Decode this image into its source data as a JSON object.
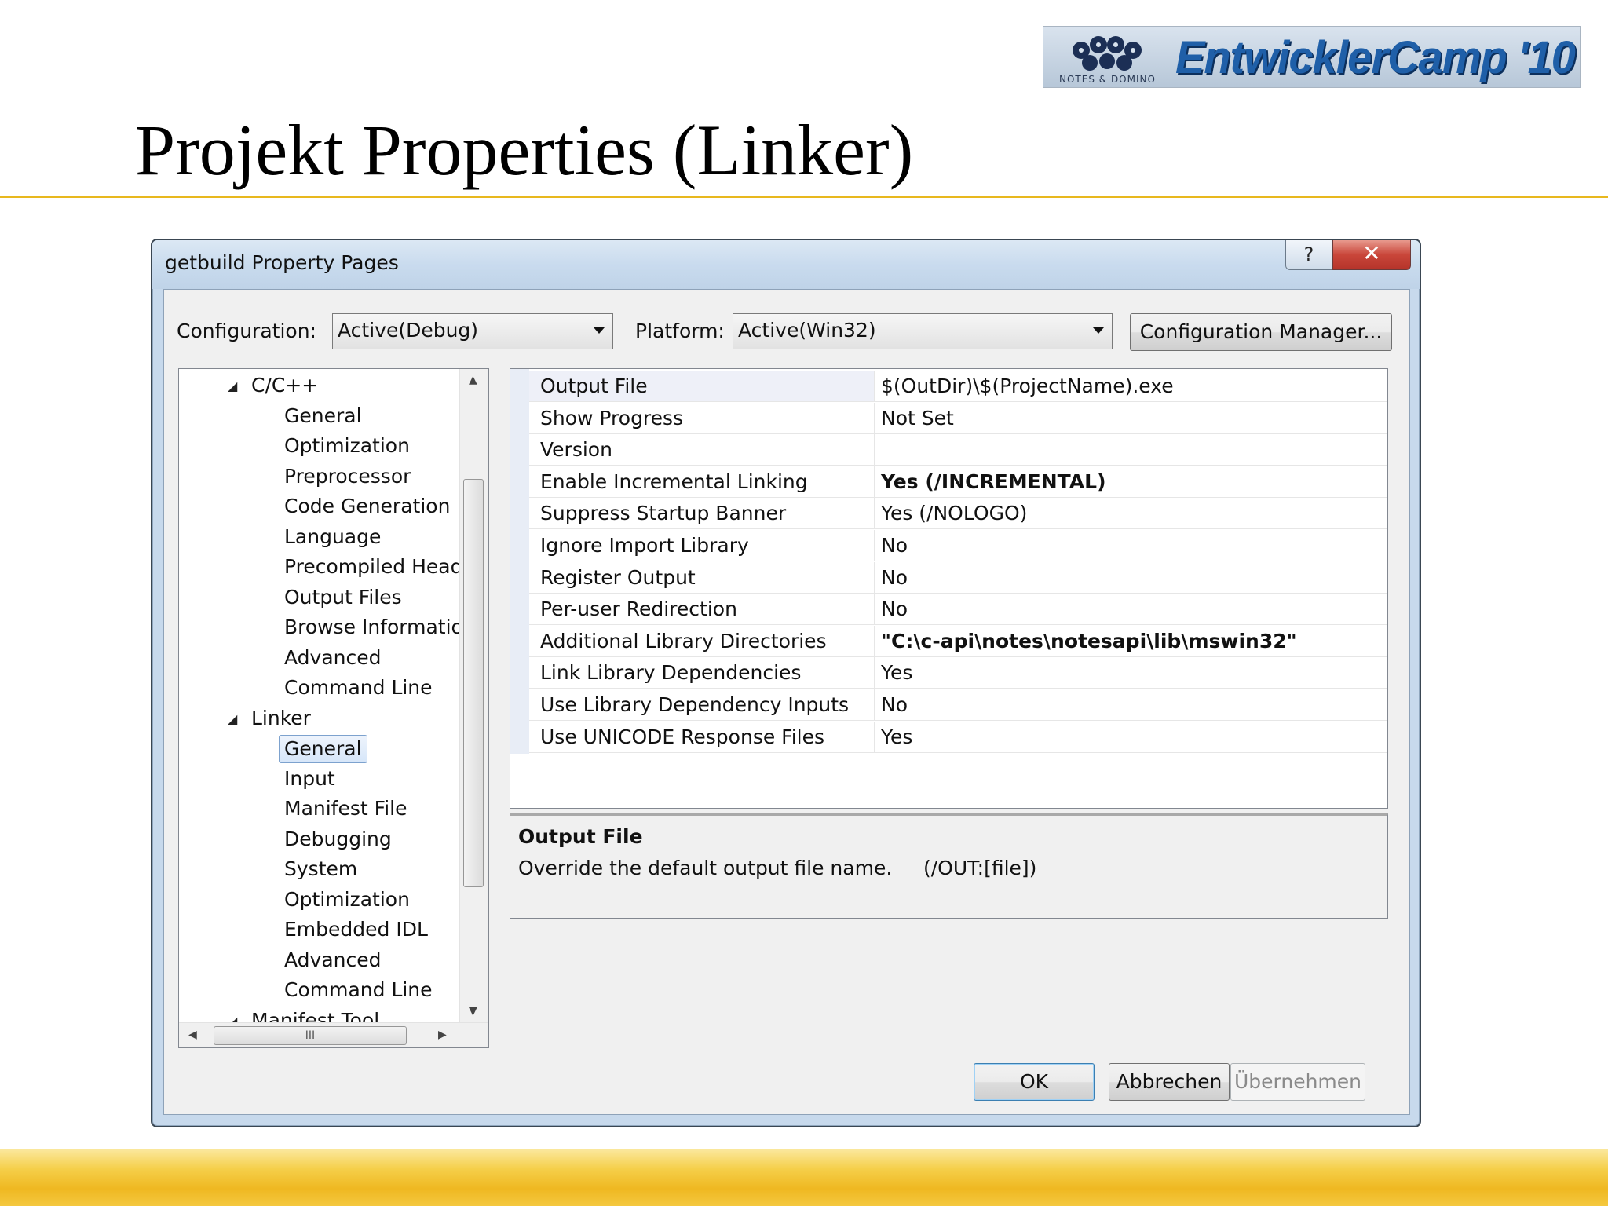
{
  "slide": {
    "title": "Projekt Properties (Linker)",
    "logo_text": "EntwicklerCamp",
    "logo_year": "'10",
    "logo_sub": "NOTES & DOMINO"
  },
  "window": {
    "title": "getbuild Property Pages",
    "help_label": "?",
    "close_label": "✕"
  },
  "toolbar": {
    "configuration_label": "Configuration:",
    "configuration_value": "Active(Debug)",
    "platform_label": "Platform:",
    "platform_value": "Active(Win32)",
    "config_manager_label": "Configuration Manager..."
  },
  "tree": {
    "items": [
      {
        "label": "C/C++",
        "level": 1,
        "expanded": true
      },
      {
        "label": "General",
        "level": 2
      },
      {
        "label": "Optimization",
        "level": 2
      },
      {
        "label": "Preprocessor",
        "level": 2
      },
      {
        "label": "Code Generation",
        "level": 2
      },
      {
        "label": "Language",
        "level": 2
      },
      {
        "label": "Precompiled Heade",
        "level": 2
      },
      {
        "label": "Output Files",
        "level": 2
      },
      {
        "label": "Browse Information",
        "level": 2
      },
      {
        "label": "Advanced",
        "level": 2
      },
      {
        "label": "Command Line",
        "level": 2
      },
      {
        "label": "Linker",
        "level": 1,
        "expanded": true
      },
      {
        "label": "General",
        "level": 2,
        "selected": true
      },
      {
        "label": "Input",
        "level": 2
      },
      {
        "label": "Manifest File",
        "level": 2
      },
      {
        "label": "Debugging",
        "level": 2
      },
      {
        "label": "System",
        "level": 2
      },
      {
        "label": "Optimization",
        "level": 2
      },
      {
        "label": "Embedded IDL",
        "level": 2
      },
      {
        "label": "Advanced",
        "level": 2
      },
      {
        "label": "Command Line",
        "level": 2
      },
      {
        "label": "Manifest Tool",
        "level": 1,
        "expanded": true
      }
    ],
    "hscroll_grip": "III"
  },
  "properties": [
    {
      "name": "Output File",
      "value": "$(OutDir)\\$(ProjectName).exe",
      "bold": false,
      "selected": true
    },
    {
      "name": "Show Progress",
      "value": "Not Set",
      "bold": false
    },
    {
      "name": "Version",
      "value": "",
      "bold": false
    },
    {
      "name": "Enable Incremental Linking",
      "value": "Yes (/INCREMENTAL)",
      "bold": true
    },
    {
      "name": "Suppress Startup Banner",
      "value": "Yes (/NOLOGO)",
      "bold": false
    },
    {
      "name": "Ignore Import Library",
      "value": "No",
      "bold": false
    },
    {
      "name": "Register Output",
      "value": "No",
      "bold": false
    },
    {
      "name": "Per-user Redirection",
      "value": "No",
      "bold": false
    },
    {
      "name": "Additional Library Directories",
      "value": "\"C:\\c-api\\notes\\notesapi\\lib\\mswin32\"",
      "bold": true
    },
    {
      "name": "Link Library Dependencies",
      "value": "Yes",
      "bold": false
    },
    {
      "name": "Use Library Dependency Inputs",
      "value": "No",
      "bold": false
    },
    {
      "name": "Use UNICODE Response Files",
      "value": "Yes",
      "bold": false
    }
  ],
  "description": {
    "title": "Output File",
    "text": "Override the default output file name.     (/OUT:[file])"
  },
  "buttons": {
    "ok": "OK",
    "cancel": "Abbrechen",
    "apply": "Übernehmen"
  },
  "colors": {
    "accent_rule": "#e8b81e",
    "logo_text": "#1f5fa8",
    "selection_border": "#7da2ce",
    "close_button": "#c9463a"
  }
}
